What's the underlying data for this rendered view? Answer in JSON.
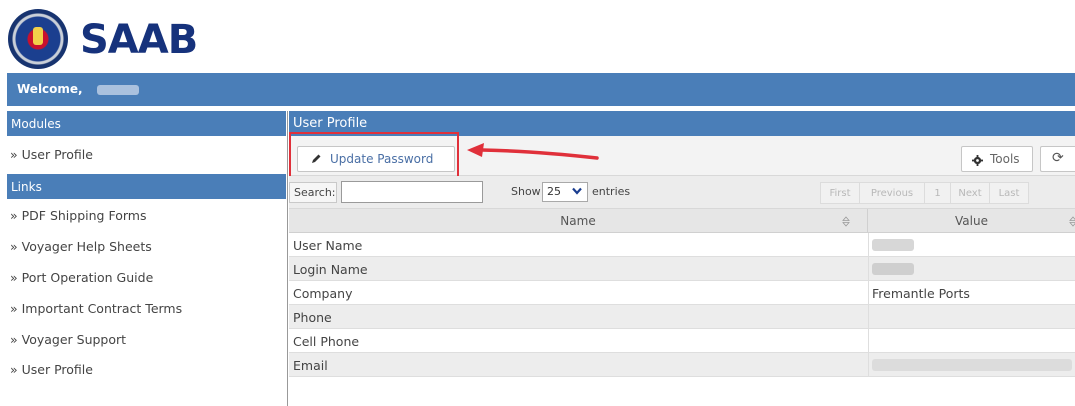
{
  "brand": {
    "name": "SAAB",
    "emblem_icon": "saab-griffin-emblem-icon"
  },
  "welcome": {
    "label": "Welcome,"
  },
  "sidebar": {
    "modules_heading": "Modules",
    "modules": [
      {
        "label": "» User Profile"
      }
    ],
    "links_heading": "Links",
    "links": [
      {
        "label": "» PDF Shipping Forms"
      },
      {
        "label": "» Voyager Help Sheets"
      },
      {
        "label": "» Port Operation Guide"
      },
      {
        "label": "» Important Contract Terms"
      },
      {
        "label": "» Voyager Support"
      },
      {
        "label": "» User Profile"
      }
    ]
  },
  "main": {
    "title": "User Profile",
    "toolbar": {
      "update_password_label": "Update Password",
      "update_password_icon": "pencil-icon",
      "tools_label": "Tools",
      "tools_icon": "gear-icon",
      "refresh_icon": "refresh-icon"
    },
    "annotation": {
      "highlight_color": "#e0303a",
      "arrow_icon": "red-arrow-icon"
    },
    "search": {
      "label": "Search:",
      "value": ""
    },
    "length": {
      "show_label": "Show",
      "selected": "25",
      "entries_label": "entries"
    },
    "pager": [
      "First",
      "Previous",
      "1",
      "Next",
      "Last"
    ],
    "table": {
      "columns": [
        "Name",
        "Value"
      ],
      "rows": [
        {
          "name": "User Name",
          "value": ""
        },
        {
          "name": "Login Name",
          "value": ""
        },
        {
          "name": "Company",
          "value": "Fremantle Ports"
        },
        {
          "name": "Phone",
          "value": ""
        },
        {
          "name": "Cell Phone",
          "value": ""
        },
        {
          "name": "Email",
          "value": ""
        }
      ]
    }
  },
  "colors": {
    "accent": "#4a7eb8",
    "brand_navy": "#16327c"
  }
}
